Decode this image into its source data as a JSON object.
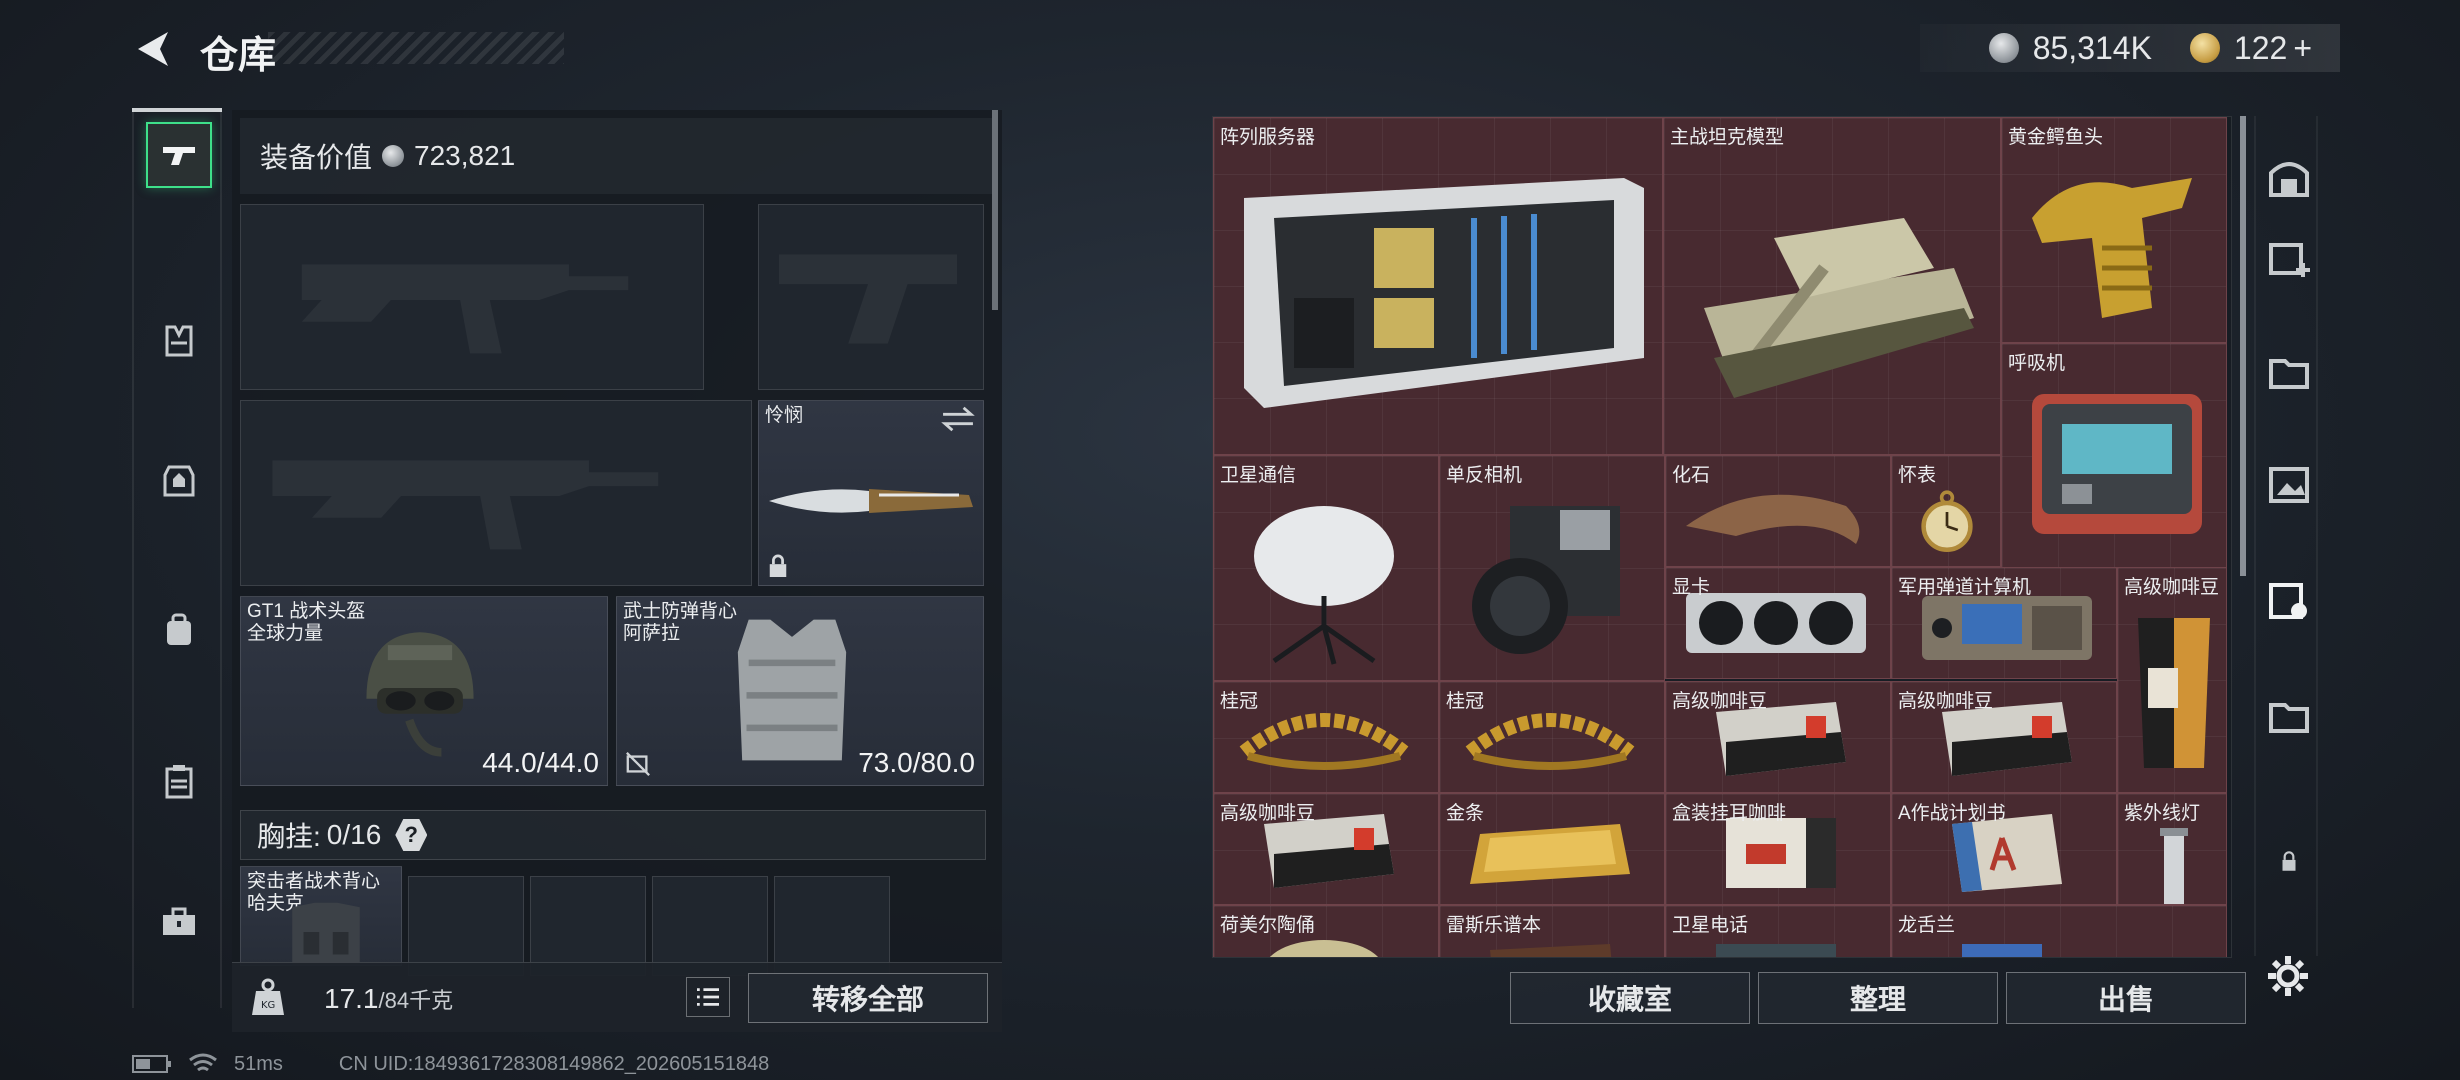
{
  "header": {
    "title": "仓库"
  },
  "currency": {
    "silver": "85,314K",
    "gold": "122",
    "gold_plus": "+"
  },
  "loadout": {
    "equip_value_label": "装备价值",
    "equip_value": "723,821",
    "melee": {
      "name": "怜悯"
    },
    "helmet": {
      "name": "GT1 战术头盔\n全球力量",
      "durability": "44.0/44.0"
    },
    "armor": {
      "name": "武士防弹背心\n阿萨拉",
      "durability": "73.0/80.0"
    },
    "rig": {
      "label": "胸挂:",
      "value": "0/16",
      "help": "?"
    },
    "backpack": {
      "name": "突击者战术背心\n哈夫克"
    }
  },
  "weight": {
    "current": "17.1",
    "max": "/84千克"
  },
  "buttons": {
    "transfer_all": "转移全部",
    "collection": "收藏室",
    "organize": "整理",
    "sell": "出售"
  },
  "storage_items": [
    {
      "name": "阵列服务器",
      "icon": "server"
    },
    {
      "name": "主战坦克模型",
      "icon": "tank"
    },
    {
      "name": "黄金鳄鱼头",
      "icon": "gold-croc"
    },
    {
      "name": "呼吸机",
      "icon": "ventilator"
    },
    {
      "name": "卫星通信",
      "icon": "satellite-dish"
    },
    {
      "name": "单反相机",
      "icon": "camera"
    },
    {
      "name": "化石",
      "icon": "fossil"
    },
    {
      "name": "怀表",
      "icon": "pocket-watch"
    },
    {
      "name": "显卡",
      "icon": "gpu"
    },
    {
      "name": "军用弹道计算机",
      "icon": "ballistic-computer"
    },
    {
      "name": "高级咖啡豆",
      "icon": "coffee-bag"
    },
    {
      "name": "桂冠",
      "icon": "laurel"
    },
    {
      "name": "桂冠",
      "icon": "laurel"
    },
    {
      "name": "高级咖啡豆",
      "icon": "coffee-pack"
    },
    {
      "name": "高级咖啡豆",
      "icon": "coffee-pack"
    },
    {
      "name": "高级咖啡豆",
      "icon": "coffee-pack"
    },
    {
      "name": "金条",
      "icon": "gold-bar"
    },
    {
      "name": "盒装挂耳咖啡",
      "icon": "coffee-box"
    },
    {
      "name": "A作战计划书",
      "icon": "plan-book"
    },
    {
      "name": "紫外线灯",
      "icon": "uv-lamp"
    },
    {
      "name": "荷美尔陶俑",
      "icon": "figurine"
    },
    {
      "name": "雷斯乐谱本",
      "icon": "music-book"
    },
    {
      "name": "卫星电话",
      "icon": "sat-phone"
    },
    {
      "name": "龙舌兰",
      "icon": "tequila"
    }
  ],
  "status": {
    "ping": "51ms",
    "uid": "CN UID:1849361728308149862_202605151848"
  },
  "colors": {
    "rare_item_bg": "#482a30",
    "selected_rail": "#3ee08a",
    "panel": "#1e242c"
  }
}
